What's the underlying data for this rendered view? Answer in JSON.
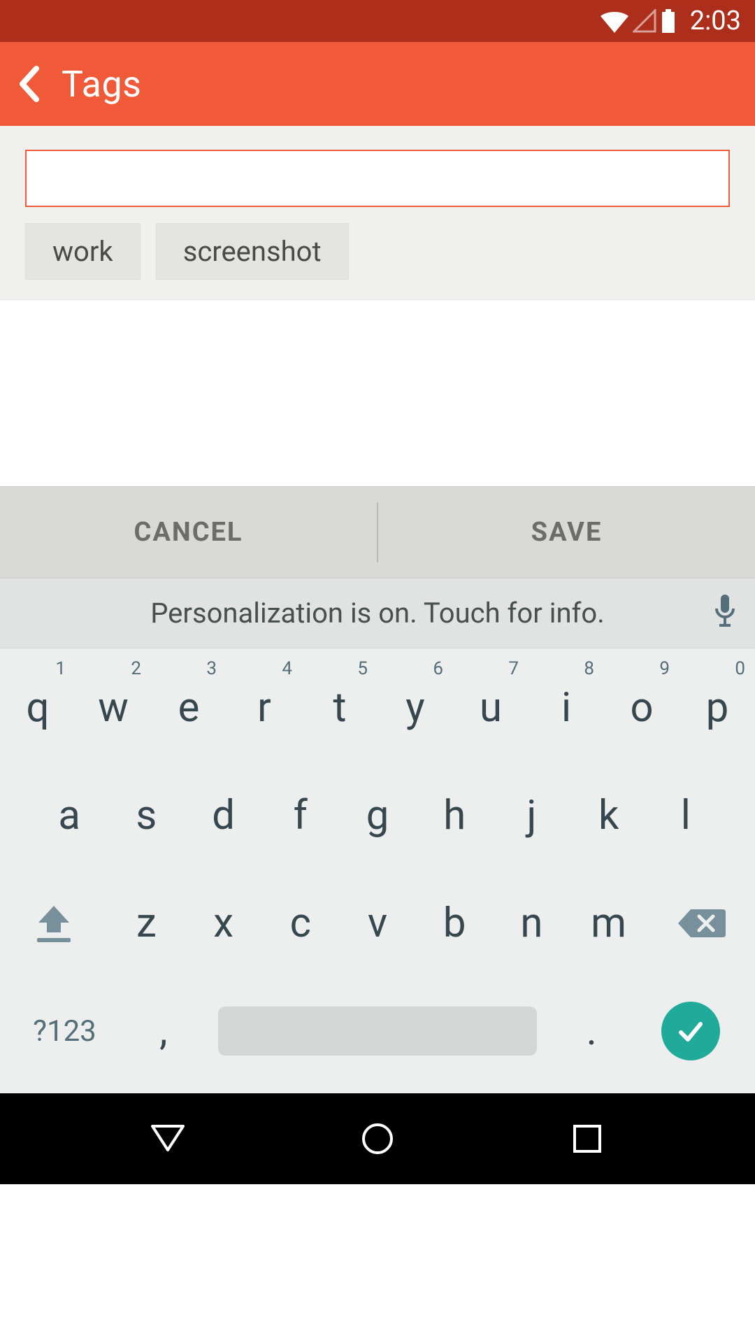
{
  "status": {
    "time": "2:03"
  },
  "appbar": {
    "title": "Tags"
  },
  "input": {
    "value": "",
    "placeholder": ""
  },
  "tags": [
    "work",
    "screenshot"
  ],
  "actions": {
    "cancel": "CANCEL",
    "save": "SAVE"
  },
  "suggestion": {
    "text": "Personalization is on. Touch for info."
  },
  "keyboard": {
    "row1": [
      {
        "k": "q",
        "h": "1"
      },
      {
        "k": "w",
        "h": "2"
      },
      {
        "k": "e",
        "h": "3"
      },
      {
        "k": "r",
        "h": "4"
      },
      {
        "k": "t",
        "h": "5"
      },
      {
        "k": "y",
        "h": "6"
      },
      {
        "k": "u",
        "h": "7"
      },
      {
        "k": "i",
        "h": "8"
      },
      {
        "k": "o",
        "h": "9"
      },
      {
        "k": "p",
        "h": "0"
      }
    ],
    "row2": [
      "a",
      "s",
      "d",
      "f",
      "g",
      "h",
      "j",
      "k",
      "l"
    ],
    "row3": [
      "z",
      "x",
      "c",
      "v",
      "b",
      "n",
      "m"
    ],
    "row4": {
      "sym": "?123",
      "comma": ",",
      "period": "."
    }
  }
}
